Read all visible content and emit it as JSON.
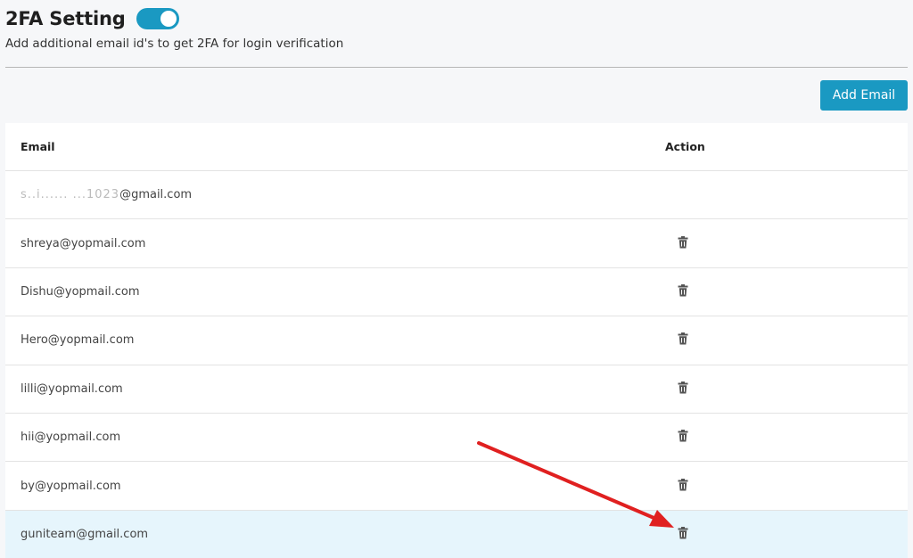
{
  "header": {
    "title": "2FA Setting",
    "subtitle": "Add additional email id's to get 2FA for login verification",
    "toggle_on": true
  },
  "toolbar": {
    "add_email_label": "Add Email"
  },
  "table": {
    "columns": [
      "Email",
      "Action"
    ],
    "rows": [
      {
        "email_masked": "s..i...... ...1023",
        "email_suffix": "@gmail.com",
        "deletable": false
      },
      {
        "email": "shreya@yopmail.com",
        "deletable": true
      },
      {
        "email": "Dishu@yopmail.com",
        "deletable": true
      },
      {
        "email": "Hero@yopmail.com",
        "deletable": true
      },
      {
        "email": "lilli@yopmail.com",
        "deletable": true
      },
      {
        "email": "hii@yopmail.com",
        "deletable": true
      },
      {
        "email": "by@yopmail.com",
        "deletable": true
      },
      {
        "email": "guniteam@gmail.com",
        "deletable": true,
        "highlighted": true
      }
    ]
  },
  "colors": {
    "accent": "#1a99c2",
    "highlight_row": "#e6f5fc",
    "annotation_arrow": "#e02020"
  },
  "icons": {
    "delete": "trash-icon"
  }
}
